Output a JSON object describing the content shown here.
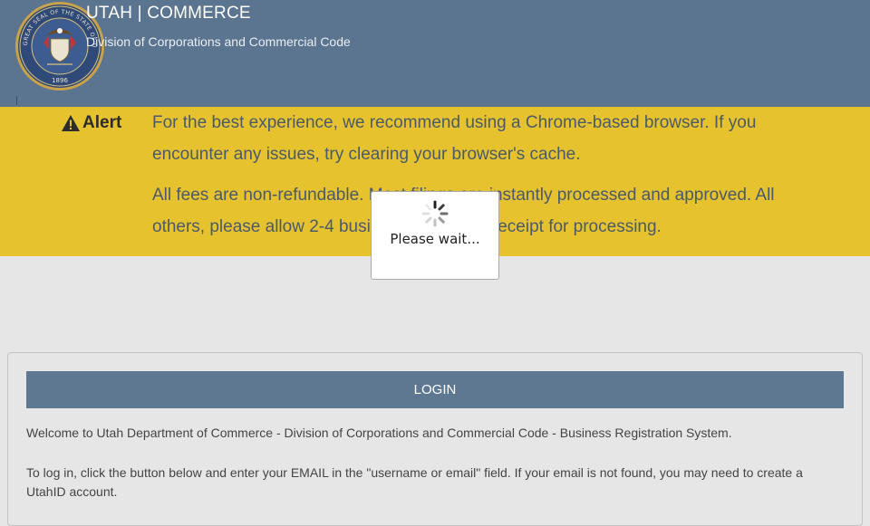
{
  "header": {
    "brand_title": "UTAH | COMMERCE",
    "brand_subtitle": "Division of Corporations and Commercial Code",
    "seal_icon": "utah-great-seal",
    "seal_text_top": "THE GREAT SEAL OF THE STATE OF UTAH",
    "seal_year": "1896",
    "background": "#5b7490"
  },
  "alert": {
    "label": "Alert",
    "icon": "warning-triangle-icon",
    "paragraph1": "For the best experience, we recommend using a Chrome-based browser. If you encounter any issues, try clearing your browser's cache.",
    "paragraph2": "All fees are non-refundable. Most filings are instantly processed and approved. All others, please allow 2-4 business days from receipt for processing.",
    "background": "#e6c22f"
  },
  "loading_dialog": {
    "text": "Please wait..."
  },
  "login": {
    "bar_label": "LOGIN",
    "welcome": "Welcome to Utah Department of Commerce - Division of Corporations and Commercial Code - Business Registration System.",
    "instructions": "To log in, click the button below and enter your EMAIL in the \"username or email\" field. If your email is not found, you may need to create a UtahID account.",
    "bar_color": "#5f7892"
  }
}
